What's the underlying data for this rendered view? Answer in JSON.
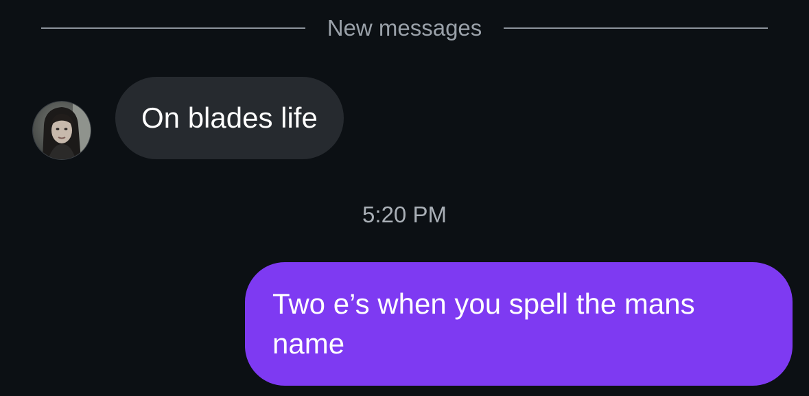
{
  "divider": {
    "label": "New messages"
  },
  "incoming": {
    "text": "On blades life"
  },
  "timestamp": "5:20 PM",
  "outgoing": {
    "text": "Two e’s when you spell the mans name"
  },
  "colors": {
    "background": "#0c1014",
    "incoming_bubble": "#262a2f",
    "outgoing_bubble": "#7e3af2",
    "secondary_text": "#9aa1a9"
  }
}
